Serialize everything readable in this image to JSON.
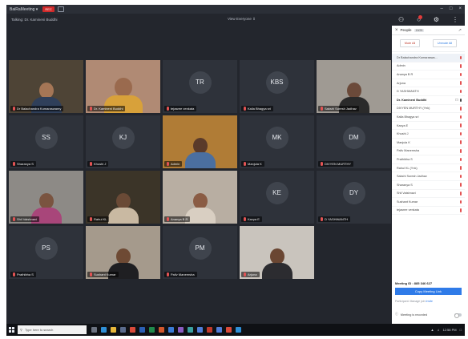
{
  "app": {
    "name": "BaiRaMeeting ▾",
    "rec_label": "REC"
  },
  "talking": "Talking: Dr. Kamineni Buddhi",
  "view_select": "View Everyone ⇕",
  "tiles": [
    {
      "id": "balachandra",
      "label": "Dr Balachandra Kumaraswamy",
      "initials": "",
      "type": "video"
    },
    {
      "id": "kamineni",
      "label": "Dr. Kamineni Buddhi",
      "initials": "",
      "type": "video"
    },
    {
      "id": "tr",
      "label": "tejasree venkata",
      "initials": "TR",
      "type": "avatar"
    },
    {
      "id": "kbs",
      "label": "Kalla Bhagya sri",
      "initials": "KBS",
      "type": "avatar"
    },
    {
      "id": "sakshi",
      "label": "Sakshi Suresh Jadhav",
      "initials": "",
      "type": "video"
    },
    {
      "id": "ss",
      "label": "Sharanya S",
      "initials": "SS",
      "type": "avatar"
    },
    {
      "id": "kj",
      "label": "Khushi J",
      "initials": "KJ",
      "type": "avatar"
    },
    {
      "id": "admin",
      "label": "Admin",
      "initials": "",
      "type": "video"
    },
    {
      "id": "mk",
      "label": "Manjula K",
      "initials": "MK",
      "type": "avatar"
    },
    {
      "id": "dm",
      "label": "DIVYEN MURTHY",
      "initials": "DM",
      "type": "avatar"
    },
    {
      "id": "shilvaishnavi",
      "label": "Shil Vaishnavi",
      "initials": "",
      "type": "video"
    },
    {
      "id": "rahul",
      "label": "Rahul KL",
      "initials": "",
      "type": "video"
    },
    {
      "id": "ananya",
      "label": "Ananya B R",
      "initials": "",
      "type": "video"
    },
    {
      "id": "ke",
      "label": "Kavya E",
      "initials": "KE",
      "type": "avatar"
    },
    {
      "id": "dy",
      "label": "D YASHWANTH",
      "initials": "DY",
      "type": "avatar"
    },
    {
      "id": "ps",
      "label": "Prathibha S",
      "initials": "PS",
      "type": "avatar"
    },
    {
      "id": "sushant",
      "label": "Sushant Kumar",
      "initials": "",
      "type": "video"
    },
    {
      "id": "pm",
      "label": "Pallv Manemsha",
      "initials": "PM",
      "type": "avatar"
    },
    {
      "id": "arjuna",
      "label": "Arjuna",
      "initials": "",
      "type": "video"
    }
  ],
  "panel": {
    "title": "People",
    "count": "19/25",
    "mute_all": "Mute All",
    "unmute_all": "Unmute All",
    "participants": [
      "Dr Balachandra Kumaraswa...",
      "Admin",
      "Ananya B R",
      "Arjuna",
      "D YASHWANTH",
      "Dr. Kamineni Buddhi",
      "DIVYEN MURTHY (Ynk)",
      "Kalla Bhagya sri",
      "Kavya E",
      "Khushi J",
      "Manjula K",
      "Pallv Manemsha",
      "Prathibha S",
      "Rahul KL (Ynk)",
      "Sakshi Suresh Jadhav",
      "Sharanya S",
      "Shil Vaishnavi",
      "Sushant Kumar",
      "tejasree venkata"
    ],
    "meeting_id_label": "Meeting ID :",
    "meeting_id_value": "885 346 627",
    "copy_link": "Copy Meeting Link",
    "info_text": "Participant: Manage join",
    "info_link": "Invite",
    "record_text": "Meeting is recorded"
  },
  "taskbar": {
    "search_placeholder": "Type here to search",
    "time": "12:58 PM"
  }
}
